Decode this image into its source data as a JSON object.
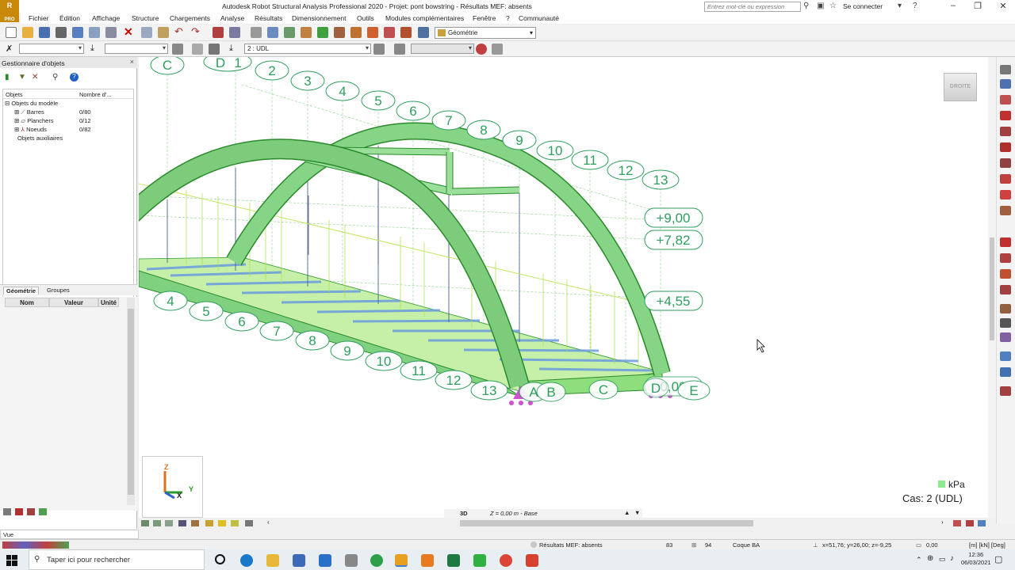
{
  "titlebar": {
    "logo_text": "R",
    "logo_sub": "PRO",
    "title": "Autodesk Robot Structural Analysis Professional 2020 - Projet: pont bowstring - Résultats MEF: absents",
    "search_placeholder": "Entrez mot-clé ou expression",
    "signin": "Se connecter",
    "help": "?"
  },
  "menu": [
    "Fichier",
    "Édition",
    "Affichage",
    "Structure",
    "Chargements",
    "Analyse",
    "Résultats",
    "Dimensionnement",
    "Outils",
    "Modules complémentaires",
    "Fenêtre",
    "?",
    "Communauté"
  ],
  "toolbar": {
    "view_select": "Géométrie",
    "case_select": "2 : UDL"
  },
  "object_manager": {
    "title": "Gestionnaire d'objets",
    "col_objects": "Objets",
    "col_count": "Nombre d'...",
    "tree": [
      {
        "label": "Objets du modèle",
        "count": "",
        "level": 0
      },
      {
        "label": "Barres",
        "count": "0/80",
        "level": 1
      },
      {
        "label": "Planchers",
        "count": "0/12",
        "level": 1
      },
      {
        "label": "Noeuds",
        "count": "0/82",
        "level": 1
      },
      {
        "label": "Objets auxiliaires",
        "count": "",
        "level": 0
      }
    ],
    "tabs": [
      "Géométrie",
      "Groupes"
    ],
    "prop_headers": [
      "Nom",
      "Valeur",
      "Unité"
    ]
  },
  "viewport": {
    "cube_label": "DROITE",
    "unit": "kPa",
    "case_label": "Cas: 2 (UDL)",
    "axes": {
      "z": "Z",
      "x": "X",
      "y": "Y"
    },
    "top_axis_labels": [
      "C",
      "D",
      "1",
      "2",
      "3",
      "4",
      "5",
      "6",
      "7",
      "8",
      "9",
      "10",
      "11",
      "12",
      "13"
    ],
    "bottom_axis_labels": [
      "4",
      "5",
      "6",
      "7",
      "8",
      "9",
      "10",
      "11",
      "12",
      "13"
    ],
    "cross_axis_labels": [
      "A",
      "B",
      "C",
      "D",
      "E"
    ],
    "level_labels": [
      "+9,00",
      "+7,82",
      "+4,55",
      "0,00"
    ]
  },
  "view_tabs": {
    "mode": "3D",
    "level": "Z = 0,00 m - Base"
  },
  "status": {
    "vue": "Vue",
    "fem": "Résultats MEF: absents",
    "nodes": "83",
    "bars": "94",
    "section": "Coque BA",
    "coords": "x=51,76; y=26,00; z=-9,25",
    "angle": "0,00",
    "units": "[m] [kN] [Deg]"
  },
  "taskbar": {
    "search": "Taper ici pour rechercher",
    "time": "12:36",
    "date": "06/03/2021"
  },
  "colors": {
    "structure_green": "#6cc46c",
    "label_green": "#2e9e5e",
    "support_magenta": "#d050d0",
    "accent_orange": "#c8880a"
  }
}
